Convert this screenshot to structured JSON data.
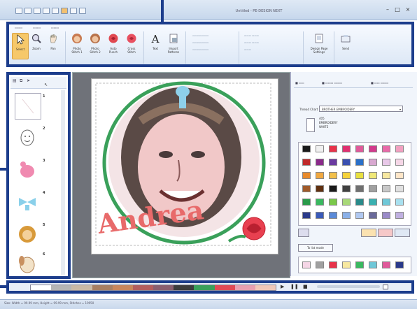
{
  "app": {
    "window_title": "Untitled - PE-DESIGN NEXT"
  },
  "ribbon": {
    "buttons": [
      {
        "label": "Select"
      },
      {
        "label": "Zoom"
      },
      {
        "label": "Pan"
      },
      {
        "label": "Photo Stitch 1"
      },
      {
        "label": "Photo Stitch 2"
      },
      {
        "label": "Auto Punch"
      },
      {
        "label": "Cross Stitch"
      },
      {
        "label": "Text"
      },
      {
        "label": "Import Patterns"
      },
      {
        "label": "Design Page Settings"
      },
      {
        "label": "Send"
      }
    ]
  },
  "design_list": {
    "items": [
      {
        "number": "1"
      },
      {
        "number": "2"
      },
      {
        "number": "3"
      },
      {
        "number": "4"
      },
      {
        "number": "5"
      },
      {
        "number": "6"
      }
    ]
  },
  "canvas": {
    "lettering": "Andrea"
  },
  "right_panel": {
    "thread_chart_label": "Thread Chart",
    "thread_chart_value": "BROTHER EMBROIDERY",
    "thread_info": [
      "405",
      "EMBROIDERY",
      "WHITE"
    ],
    "to_list_button": "To list mode",
    "palette": [
      "#1a1a1a",
      "#f0f0f0",
      "#e8334a",
      "#e03070",
      "#e05a9a",
      "#d23a8c",
      "#e86aa8",
      "#f2a0c0",
      "#c02a2a",
      "#8a2a8a",
      "#6a3aa0",
      "#3a50b0",
      "#2a70c8",
      "#d8a8d0",
      "#e8c8e8",
      "#f5d6e6",
      "#e88a2a",
      "#f0a840",
      "#f2c04a",
      "#f5d23a",
      "#e8e040",
      "#f0e878",
      "#f7e8a0",
      "#ffe6c8",
      "#a05a2a",
      "#603010",
      "#1a1a1a",
      "#404040",
      "#707070",
      "#a0a0a0",
      "#c8c8c8",
      "#e0e0e0",
      "#2a9a4a",
      "#3ab860",
      "#7ac84a",
      "#a8d878",
      "#2a8a8a",
      "#3ab0b0",
      "#70c8d8",
      "#a8e0ef",
      "#2a3a8a",
      "#3a5ab8",
      "#5a8ad8",
      "#8ab0e8",
      "#b0c8f0",
      "#6a6a9a",
      "#9a8ac8",
      "#c0b0e0"
    ],
    "recent": [
      "#f5d6e6",
      "#a0a0a0",
      "#e8334a",
      "#f7e8a0",
      "#3ab860",
      "#70c8d8",
      "#e05a9a",
      "#2a3a8a"
    ]
  },
  "bottom_bar": {
    "strip_colors": [
      "#ffffff",
      "#b5b5b5",
      "#c9b9a6",
      "#a77f63",
      "#c8865c",
      "#b35e5e",
      "#8a5f6f",
      "#3c3c3c",
      "#3aa05a",
      "#e04a55",
      "#e8a0b0",
      "#f0c8b8"
    ]
  },
  "status": {
    "text": "Size: Width = 99.99 mm, Height = 99.99 mm, Stitches = 19950"
  }
}
